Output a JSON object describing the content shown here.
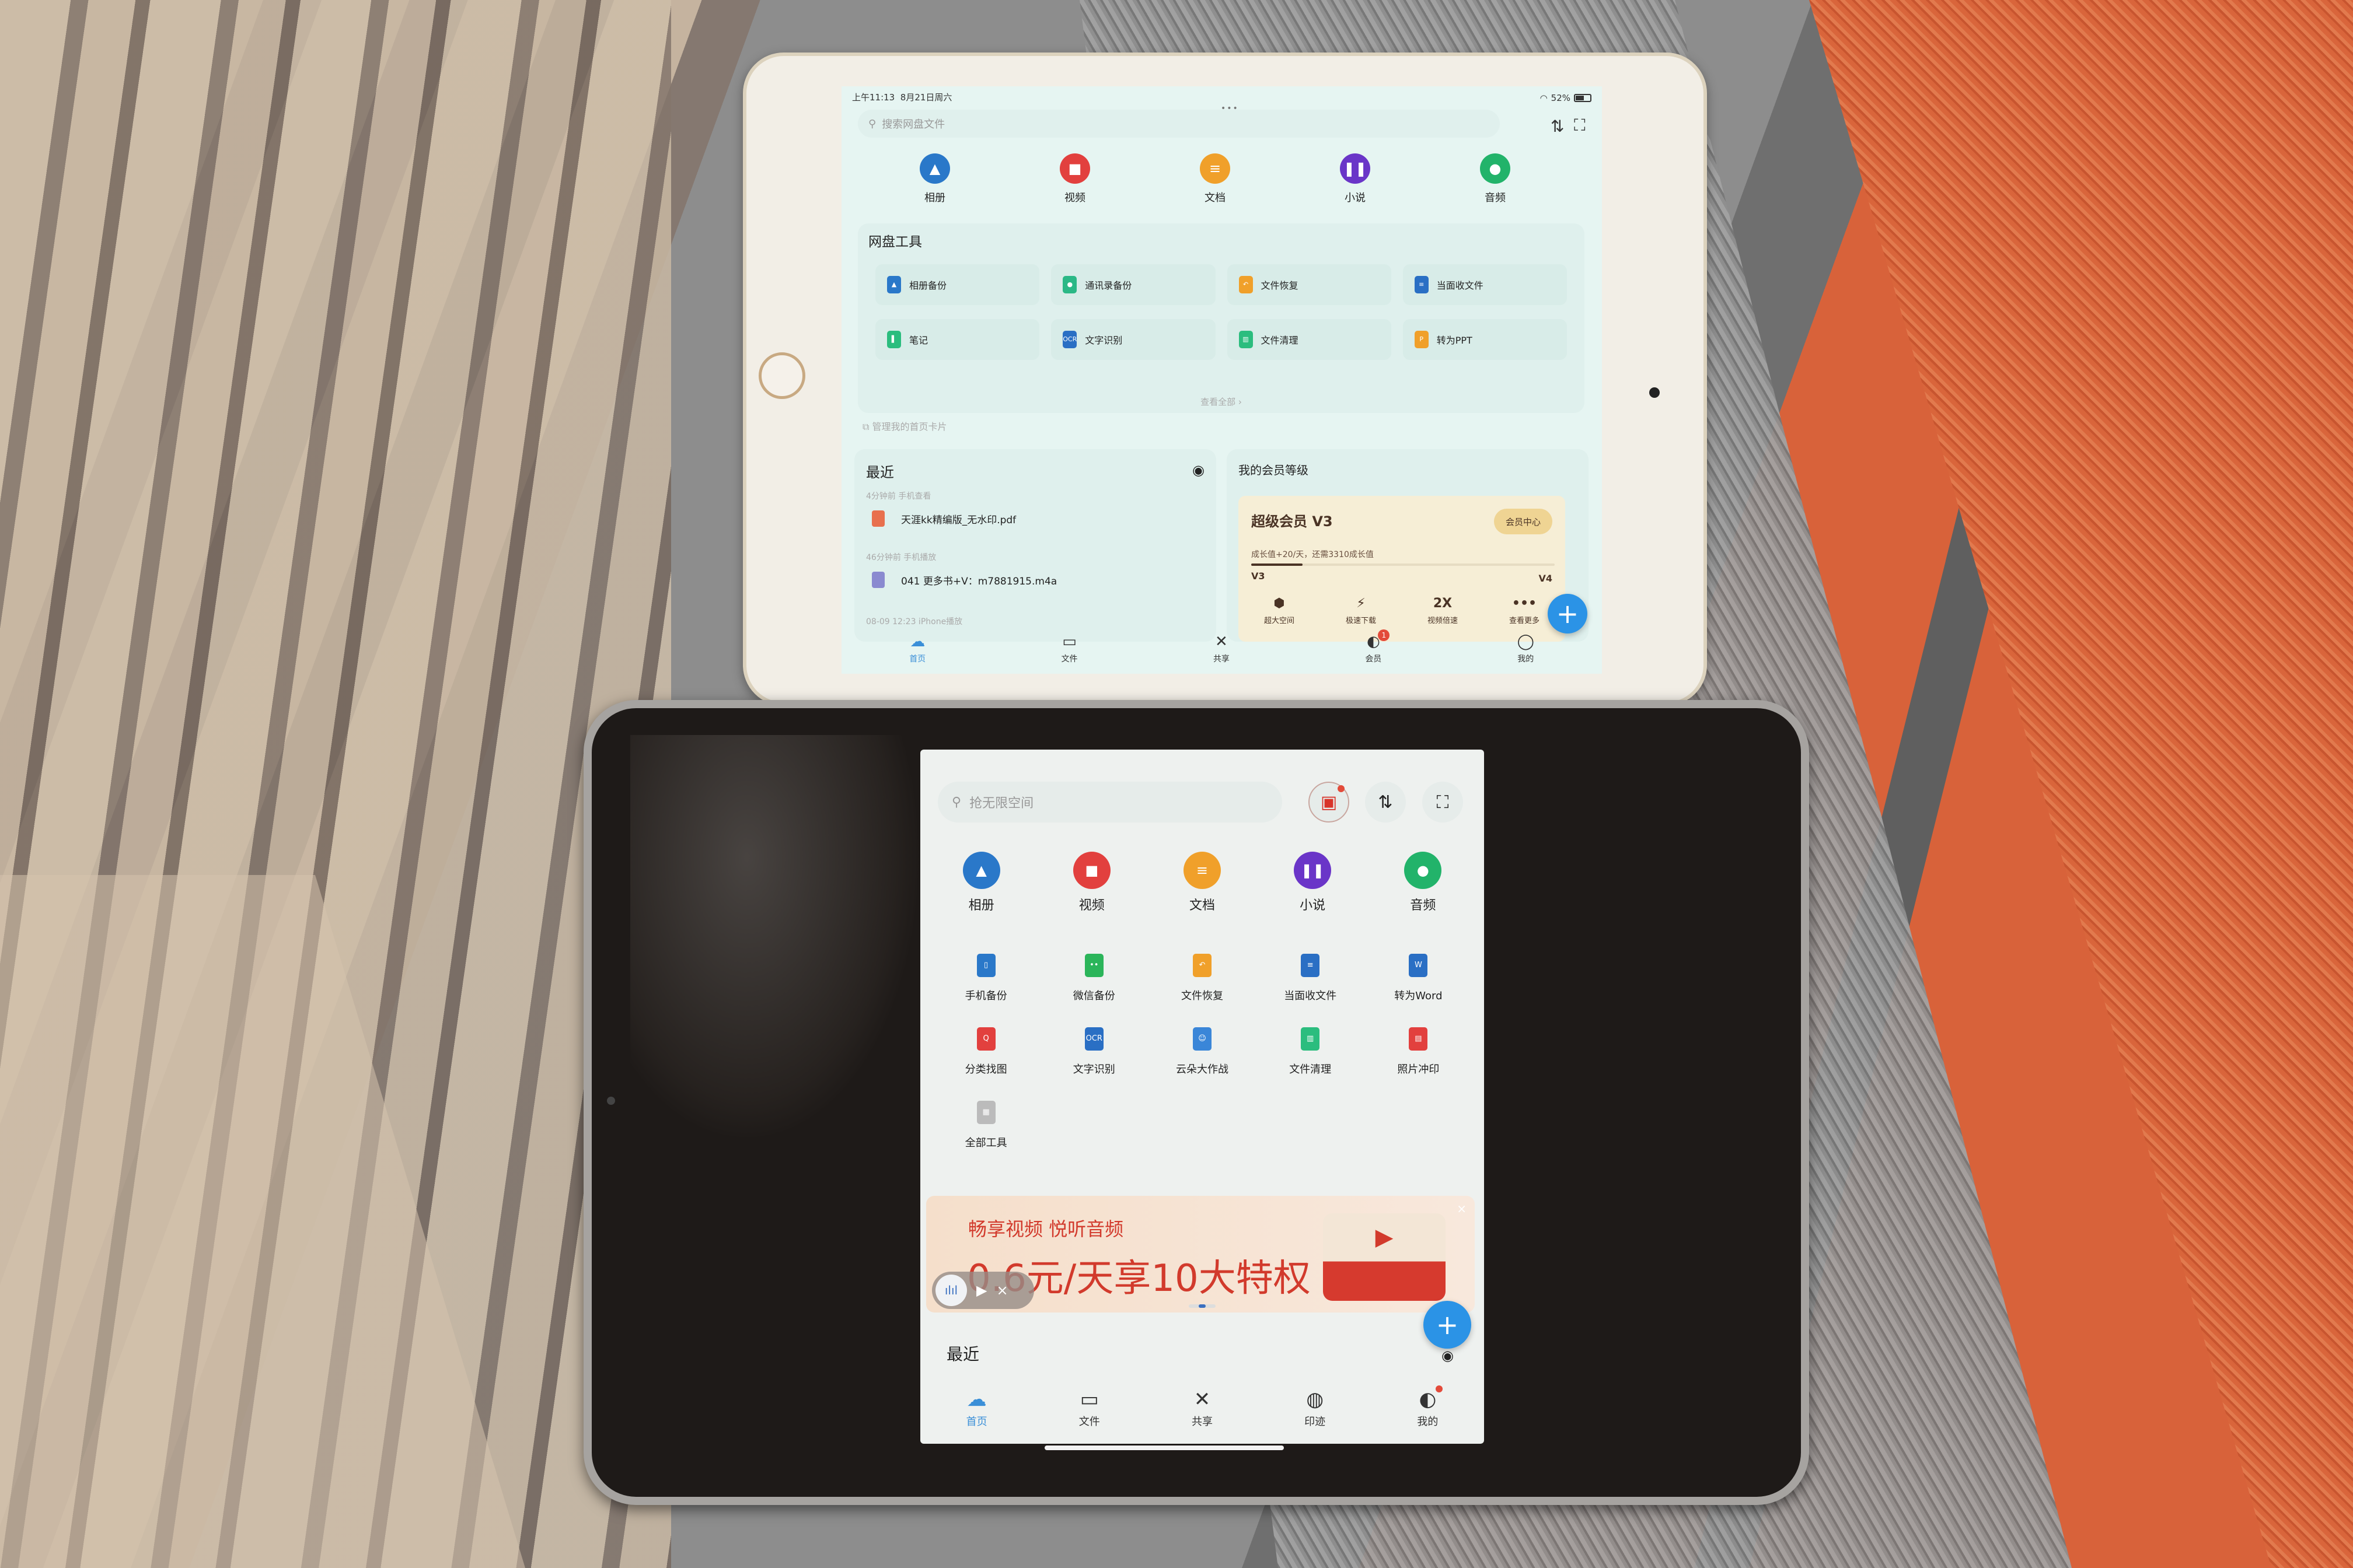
{
  "top_device": {
    "status_bar": {
      "time": "上午11:13",
      "date": "8月21日周六",
      "battery": "52%",
      "battery_fraction": 0.52,
      "dots": "•••"
    },
    "search": {
      "placeholder": "搜索网盘文件"
    },
    "toolbar": {
      "transfer_icon": "⇅",
      "scan_icon": "⛶"
    },
    "categories": [
      {
        "label": "相册",
        "icon": "album-icon",
        "glyph": "▲",
        "color": "#2a78c9"
      },
      {
        "label": "视频",
        "icon": "video-icon",
        "glyph": "■",
        "color": "#e2403e"
      },
      {
        "label": "文档",
        "icon": "document-icon",
        "glyph": "≡",
        "color": "#f0a02a"
      },
      {
        "label": "小说",
        "icon": "novel-icon",
        "glyph": "❚❚",
        "color": "#6a35c8"
      },
      {
        "label": "音频",
        "icon": "audio-icon",
        "glyph": "●",
        "color": "#22b36a"
      }
    ],
    "tools_card": {
      "title": "网盘工具",
      "items": [
        {
          "label": "相册备份",
          "color": "#2a78c9",
          "glyph": "▲"
        },
        {
          "label": "通讯录备份",
          "color": "#2bb886",
          "glyph": "●"
        },
        {
          "label": "文件恢复",
          "color": "#f0a02a",
          "glyph": "↶"
        },
        {
          "label": "当面收文件",
          "color": "#2a6fc4",
          "glyph": "≡"
        },
        {
          "label": "笔记",
          "color": "#2bbd7e",
          "glyph": "▌"
        },
        {
          "label": "文字识别",
          "color": "#2a6fc4",
          "glyph": "OCR"
        },
        {
          "label": "文件清理",
          "color": "#2bbd7e",
          "glyph": "▥"
        },
        {
          "label": "转为PPT",
          "color": "#f0a02a",
          "glyph": "P"
        }
      ],
      "more_label": "查看全部 ›"
    },
    "manage_cards": "管理我的首页卡片",
    "recent": {
      "title": "最近",
      "items": [
        {
          "meta": "4分钟前 手机查看",
          "name": "天涯kk精编版_无水印.pdf",
          "type": "pdf",
          "color": "#e8704e"
        },
        {
          "meta": "46分钟前 手机播放",
          "name": "041 更多书+V：m7881915.m4a",
          "type": "audio",
          "color": "#8a8ad0"
        }
      ],
      "trailing_meta": "08-09 12:23 iPhone播放"
    },
    "member": {
      "title": "我的会员等级",
      "level_title": "超级会员 V3",
      "center_button": "会员中心",
      "growth_text": "成长值+20/天，还需3310成长值",
      "progress_fraction": 0.17,
      "current_level": "V3",
      "next_level": "V4",
      "perks": [
        {
          "label": "超大空间",
          "icon": "box-icon",
          "glyph": "⬢"
        },
        {
          "label": "极速下载",
          "icon": "lightning-icon",
          "glyph": "⚡"
        },
        {
          "label": "视频倍速",
          "icon": "speed-2x-icon",
          "glyph": "2X"
        },
        {
          "label": "查看更多",
          "icon": "more-icon",
          "glyph": "•••"
        }
      ]
    },
    "fab": "+",
    "nav": [
      {
        "label": "首页",
        "glyph": "☁",
        "active": true
      },
      {
        "label": "文件",
        "glyph": "▭"
      },
      {
        "label": "共享",
        "glyph": "✕"
      },
      {
        "label": "会员",
        "glyph": "◐",
        "badge": "1"
      },
      {
        "label": "我的",
        "glyph": "◯"
      }
    ]
  },
  "bottom_device": {
    "search": {
      "placeholder": "抢无限空间"
    },
    "toolbar": {
      "gift_icon": "🎁",
      "transfer_icon": "⇅",
      "scan_icon": "⛶"
    },
    "categories": [
      {
        "label": "相册",
        "glyph": "▲",
        "color": "#2a78c9"
      },
      {
        "label": "视频",
        "glyph": "■",
        "color": "#e2403e"
      },
      {
        "label": "文档",
        "glyph": "≡",
        "color": "#f0a02a"
      },
      {
        "label": "小说",
        "glyph": "❚❚",
        "color": "#6a35c8"
      },
      {
        "label": "音频",
        "glyph": "●",
        "color": "#22b36a"
      }
    ],
    "tools": [
      {
        "label": "手机备份",
        "color": "#2a78c9",
        "glyph": "▯"
      },
      {
        "label": "微信备份",
        "color": "#2bb55a",
        "glyph": "••"
      },
      {
        "label": "文件恢复",
        "color": "#f0a02a",
        "glyph": "↶"
      },
      {
        "label": "当面收文件",
        "color": "#2a6fc4",
        "glyph": "≡"
      },
      {
        "label": "转为Word",
        "color": "#2a6fc4",
        "glyph": "W"
      },
      {
        "label": "分类找图",
        "color": "#e2403e",
        "glyph": "Q"
      },
      {
        "label": "文字识别",
        "color": "#2a6fc4",
        "glyph": "OCR"
      },
      {
        "label": "云朵大作战",
        "color": "#3a86d8",
        "glyph": "☺"
      },
      {
        "label": "文件清理",
        "color": "#2bbd7e",
        "glyph": "▥"
      },
      {
        "label": "照片冲印",
        "color": "#e2403e",
        "glyph": "▤"
      },
      {
        "label": "全部工具",
        "color": "#bbbbbb",
        "glyph": "▦"
      }
    ],
    "banner": {
      "line1": "畅享视频 悦听音频",
      "line2": "0.6元/天享10大特权",
      "close": "×",
      "art_glyph": "▶"
    },
    "player": {
      "wave": "ılıl",
      "play": "▶",
      "close": "×"
    },
    "fab": "+",
    "recent": {
      "title": "最近",
      "eye": "◉"
    },
    "nav": [
      {
        "label": "首页",
        "glyph": "☁",
        "active": true
      },
      {
        "label": "文件",
        "glyph": "▭"
      },
      {
        "label": "共享",
        "glyph": "✕"
      },
      {
        "label": "印迹",
        "glyph": "◍"
      },
      {
        "label": "我的",
        "glyph": "◐",
        "dot": true
      }
    ]
  }
}
